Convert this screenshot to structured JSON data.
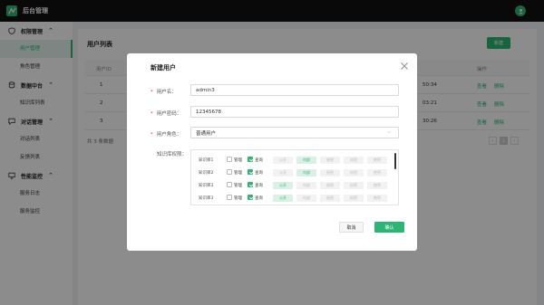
{
  "app": {
    "title": "后台管理"
  },
  "colors": {
    "accent": "#2bb673",
    "topbar": "#111111"
  },
  "sidebar": {
    "groups": [
      {
        "label": "权限管理",
        "icon": "shield-icon",
        "chevron": "^",
        "items": [
          {
            "label": "用户管理",
            "active": true
          },
          {
            "label": "角色管理"
          }
        ]
      },
      {
        "label": "数据中台",
        "icon": "database-icon",
        "chevron": "^",
        "items": [
          {
            "label": "知识库列表"
          }
        ]
      },
      {
        "label": "对话管理",
        "icon": "chat-icon",
        "chevron": "^",
        "items": [
          {
            "label": "对话列表"
          },
          {
            "label": "反馈列表"
          }
        ]
      },
      {
        "label": "性能监控",
        "icon": "monitor-icon",
        "chevron": "^",
        "items": [
          {
            "label": "服务日志"
          },
          {
            "label": "服务监控"
          }
        ]
      }
    ]
  },
  "main": {
    "title": "用户列表",
    "new_button": "新建",
    "columns": {
      "id": "用户ID",
      "actions": "操作"
    },
    "rows": [
      {
        "id": "1",
        "time": "50:34",
        "view": "查看",
        "delete": "删除"
      },
      {
        "id": "2",
        "time": "03:21",
        "view": "查看",
        "delete": "删除"
      },
      {
        "id": "3",
        "time": "30:26",
        "view": "查看",
        "delete": "删除"
      }
    ],
    "total": "共 3 条数据",
    "pager": {
      "prev": "‹",
      "current": "1",
      "next": "›"
    }
  },
  "modal": {
    "title": "新建用户",
    "fields": {
      "username": {
        "label": "用户名：",
        "value": "admin3"
      },
      "password": {
        "label": "用户密码：",
        "value": "12345678"
      },
      "role": {
        "label": "用户角色：",
        "value": "普通用户"
      }
    },
    "permissions": {
      "label": "知识库权限：",
      "manage_label": "管理",
      "read_label": "查询",
      "tags": [
        "公开",
        "内部",
        "秘密",
        "机密",
        "绝密"
      ],
      "rows": [
        {
          "name": "知识库1",
          "manage": false,
          "read": true,
          "selected_tag": 1
        },
        {
          "name": "知识库2",
          "manage": false,
          "read": true,
          "selected_tag": 1
        },
        {
          "name": "知识库3",
          "manage": false,
          "read": true,
          "selected_tag": 0
        },
        {
          "name": "知识库3",
          "manage": false,
          "read": true,
          "selected_tag": 0
        }
      ]
    },
    "cancel_button": "取消",
    "ok_button": "确认"
  }
}
